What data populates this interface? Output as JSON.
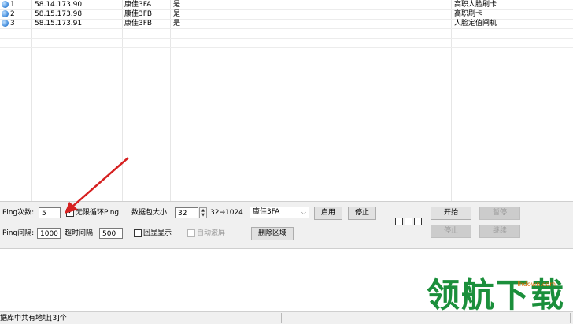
{
  "rows": [
    {
      "num": "1",
      "ip": "58.14.173.90",
      "name": "康佳3FA",
      "flag": "是",
      "remark": "高职人脸刷卡"
    },
    {
      "num": "2",
      "ip": "58.15.173.98",
      "name": "康佳3FB",
      "flag": "是",
      "remark": "高职刷卡"
    },
    {
      "num": "3",
      "ip": "58.15.173.91",
      "name": "康佳3FB",
      "flag": "是",
      "remark": "人脸定值闸机"
    }
  ],
  "controls": {
    "ping_count_label": "Ping次数:",
    "ping_count_value": "5",
    "infinite_label": "无限循环Ping",
    "packet_size_label": "数据包大小:",
    "packet_size_value": "32",
    "packet_range": "32→1024",
    "region_select": "康佳3FA",
    "enable_label": "启用",
    "disable_label": "停止",
    "ping_interval_label": "Ping间隔:",
    "ping_interval_value": "1000",
    "timeout_label": "超时间隔:",
    "timeout_value": "500",
    "echo_label": "回显显示",
    "autoscroll_label": "自动滚屏",
    "delete_region_label": "删除区域",
    "start_label": "开始",
    "pause_label": "暂停",
    "stop_label": "停止",
    "continue_label": "继续"
  },
  "status": {
    "text": "据库中共有地址[3]个"
  },
  "watermark": {
    "main": "领航下载",
    "sub": "lhdown.com"
  },
  "colors": {
    "watermark": "#1b8f3b",
    "arrow": "#d62020"
  }
}
